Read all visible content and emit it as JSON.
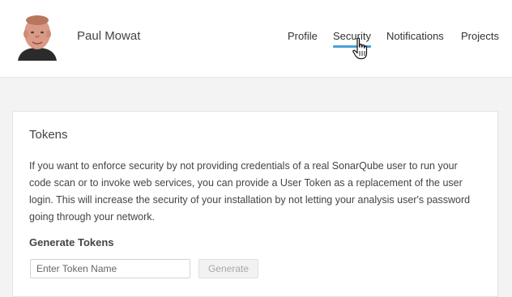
{
  "header": {
    "user_name": "Paul Mowat",
    "avatar_icon": "user-avatar-photo"
  },
  "nav": {
    "items": [
      {
        "label": "Profile",
        "active": false
      },
      {
        "label": "Security",
        "active": true
      },
      {
        "label": "Notifications",
        "active": false
      },
      {
        "label": "Projects",
        "active": false
      }
    ],
    "active_color": "#4b9fd5"
  },
  "tokens": {
    "title": "Tokens",
    "description": "If you want to enforce security by not providing credentials of a real SonarQube user to run your code scan or to invoke web services, you can provide a User Token as a replacement of the user login. This will increase the security of your installation by not letting your analysis user's password going through your network.",
    "generate_title": "Generate Tokens",
    "input_placeholder": "Enter Token Name",
    "input_value": "",
    "generate_label": "Generate"
  },
  "cursor_icon": "hand-pointer-icon"
}
